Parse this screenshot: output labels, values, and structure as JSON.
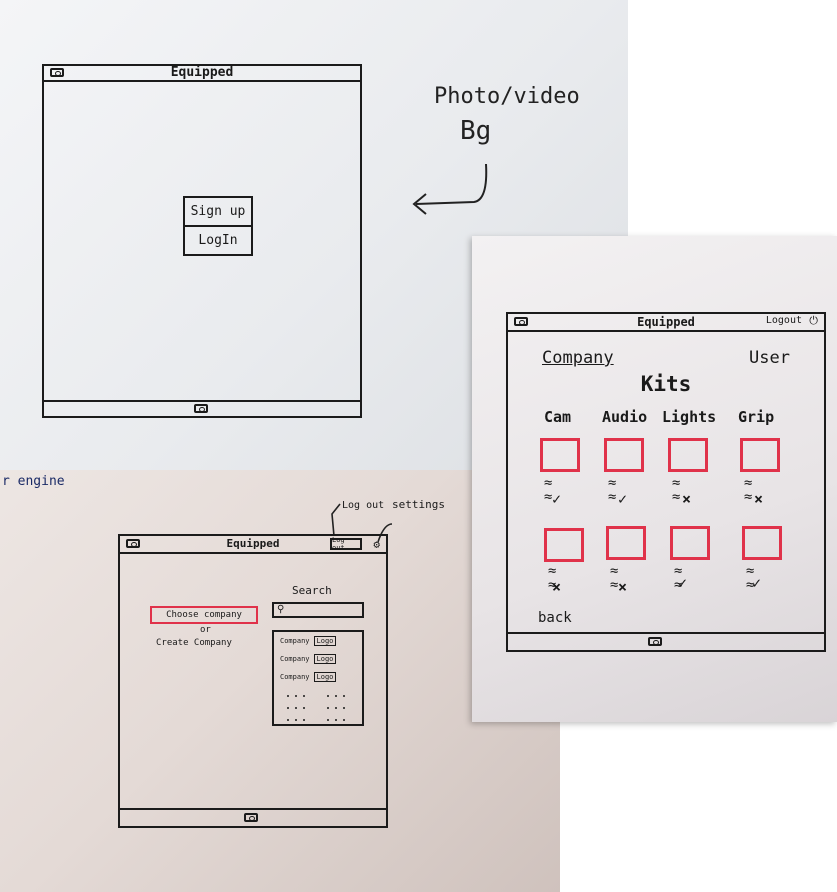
{
  "sketch1": {
    "title": "Equipped",
    "buttons": {
      "signup": "Sign up",
      "login": "LogIn"
    },
    "note_line1": "Photo/video",
    "note_line2": "Bg"
  },
  "sketch2": {
    "title": "Equipped",
    "logout_label": "Log out",
    "logout_annotation": "Log out",
    "settings_annotation": "settings",
    "choose_company": "Choose company",
    "or": "or",
    "create_company": "Create Company",
    "search_label": "Search",
    "company_rows": [
      {
        "name": "Company",
        "logo": "Logo"
      },
      {
        "name": "Company",
        "logo": "Logo"
      },
      {
        "name": "Company",
        "logo": "Logo"
      }
    ],
    "edge_text": "r engine"
  },
  "sketch3": {
    "title": "Equipped",
    "logout_label": "Logout",
    "tab_company": "Company",
    "tab_user": "User",
    "kits_title": "Kits",
    "categories": [
      "Cam",
      "Audio",
      "Lights",
      "Grip"
    ],
    "back_label": "back"
  },
  "colors": {
    "marker": "#1b1b1b",
    "highlight": "#e0324a"
  },
  "icons": [
    "camera-icon",
    "search-icon",
    "gear-icon",
    "power-icon",
    "check-icon",
    "cross-icon"
  ]
}
